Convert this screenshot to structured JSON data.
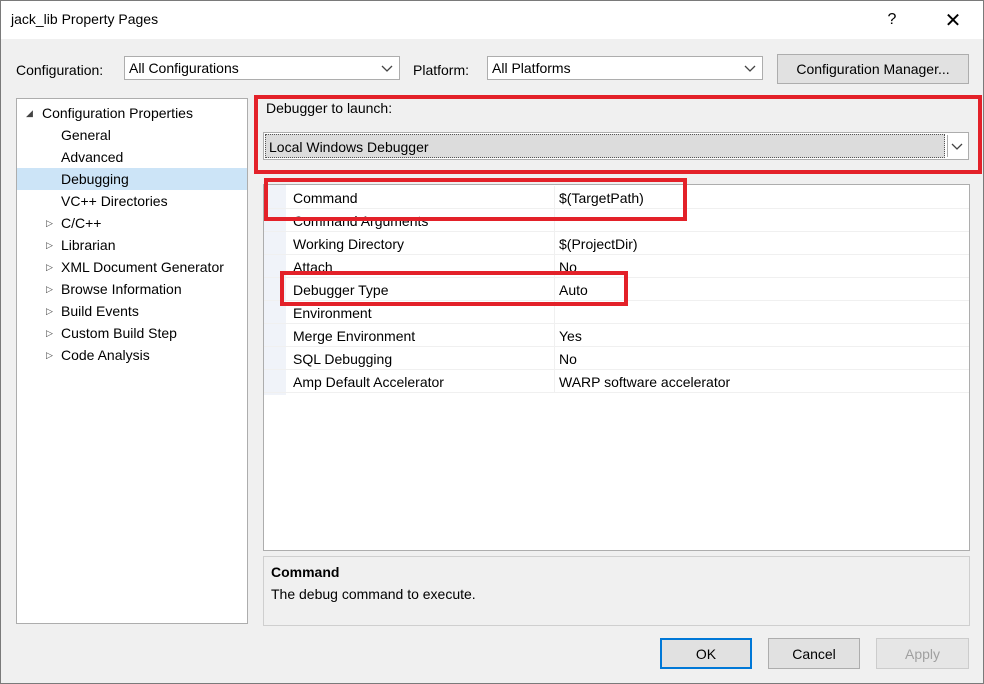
{
  "window": {
    "title": "jack_lib Property Pages",
    "help_glyph": "?",
    "close_glyph": "✕"
  },
  "toolbar": {
    "configuration_label": "Configuration:",
    "configuration_value": "All Configurations",
    "platform_label": "Platform:",
    "platform_value": "All Platforms",
    "config_manager_label": "Configuration Manager..."
  },
  "tree": {
    "root": "Configuration Properties",
    "items": [
      {
        "label": "General"
      },
      {
        "label": "Advanced"
      },
      {
        "label": "Debugging",
        "selected": true
      },
      {
        "label": "VC++ Directories"
      },
      {
        "label": "C/C++",
        "expandable": true
      },
      {
        "label": "Librarian",
        "expandable": true
      },
      {
        "label": "XML Document Generator",
        "expandable": true
      },
      {
        "label": "Browse Information",
        "expandable": true
      },
      {
        "label": "Build Events",
        "expandable": true
      },
      {
        "label": "Custom Build Step",
        "expandable": true
      },
      {
        "label": "Code Analysis",
        "expandable": true
      }
    ]
  },
  "debugger": {
    "launch_label": "Debugger to launch:",
    "launch_value": "Local Windows Debugger"
  },
  "properties": [
    {
      "name": "Command",
      "value": "$(TargetPath)"
    },
    {
      "name": "Command Arguments",
      "value": ""
    },
    {
      "name": "Working Directory",
      "value": "$(ProjectDir)"
    },
    {
      "name": "Attach",
      "value": "No"
    },
    {
      "name": "Debugger Type",
      "value": "Auto"
    },
    {
      "name": "Environment",
      "value": ""
    },
    {
      "name": "Merge Environment",
      "value": "Yes"
    },
    {
      "name": "SQL Debugging",
      "value": "No"
    },
    {
      "name": "Amp Default Accelerator",
      "value": "WARP software accelerator"
    }
  ],
  "description": {
    "title": "Command",
    "text": "The debug command to execute."
  },
  "buttons": {
    "ok": "OK",
    "cancel": "Cancel",
    "apply": "Apply"
  },
  "colors": {
    "highlight": "#e32129",
    "selection": "#cce4f7",
    "default_button_border": "#0078d7"
  }
}
